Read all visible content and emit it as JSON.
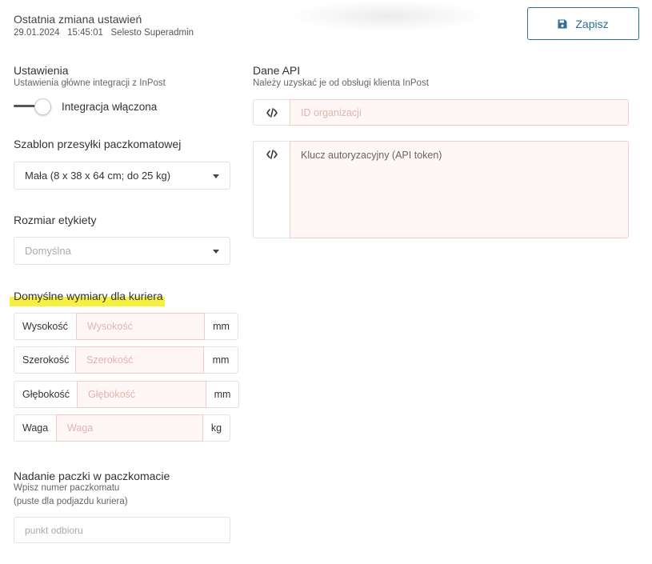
{
  "header": {
    "title": "Ostatnia zmiana ustawień",
    "date": "29.01.2024",
    "time": "15:45:01",
    "user": "Selesto Superadmin",
    "save_label": "Zapisz"
  },
  "settings": {
    "title": "Ustawienia",
    "subtitle": "Ustawienia główne integracji z InPost",
    "toggle_label": "Integracja włączona",
    "toggle_on": true
  },
  "template": {
    "title": "Szablon przesyłki paczkomatowej",
    "value": "Mała (8 x 38 x 64 cm; do 25 kg)"
  },
  "label_size": {
    "title": "Rozmiar etykiety",
    "placeholder": "Domyślna"
  },
  "courier": {
    "title": "Domyślne wymiary dla kuriera",
    "rows": [
      {
        "label": "Wysokość",
        "placeholder": "Wysokość",
        "unit": "mm"
      },
      {
        "label": "Szerokość",
        "placeholder": "Szerokość",
        "unit": "mm"
      },
      {
        "label": "Głębokość",
        "placeholder": "Głębokość",
        "unit": "mm"
      },
      {
        "label": "Waga",
        "placeholder": "Waga",
        "unit": "kg"
      }
    ]
  },
  "dropoff": {
    "title": "Nadanie paczki w paczkomacie",
    "subtitle1": "Wpisz numer paczkomatu",
    "subtitle2": "(puste dla podjazdu kuriera)",
    "placeholder": "punkt odbioru"
  },
  "api": {
    "title": "Dane API",
    "subtitle": "Należy uzyskać je od obsługi klienta InPost",
    "org_placeholder": "ID organizacji",
    "token_placeholder": "Klucz autoryzacyjny (API token)"
  },
  "colors": {
    "accent": "#2f6f93",
    "invalid_bg": "#fff6f6",
    "invalid_border": "#f2cccc",
    "highlight": "#f5ef2a"
  }
}
